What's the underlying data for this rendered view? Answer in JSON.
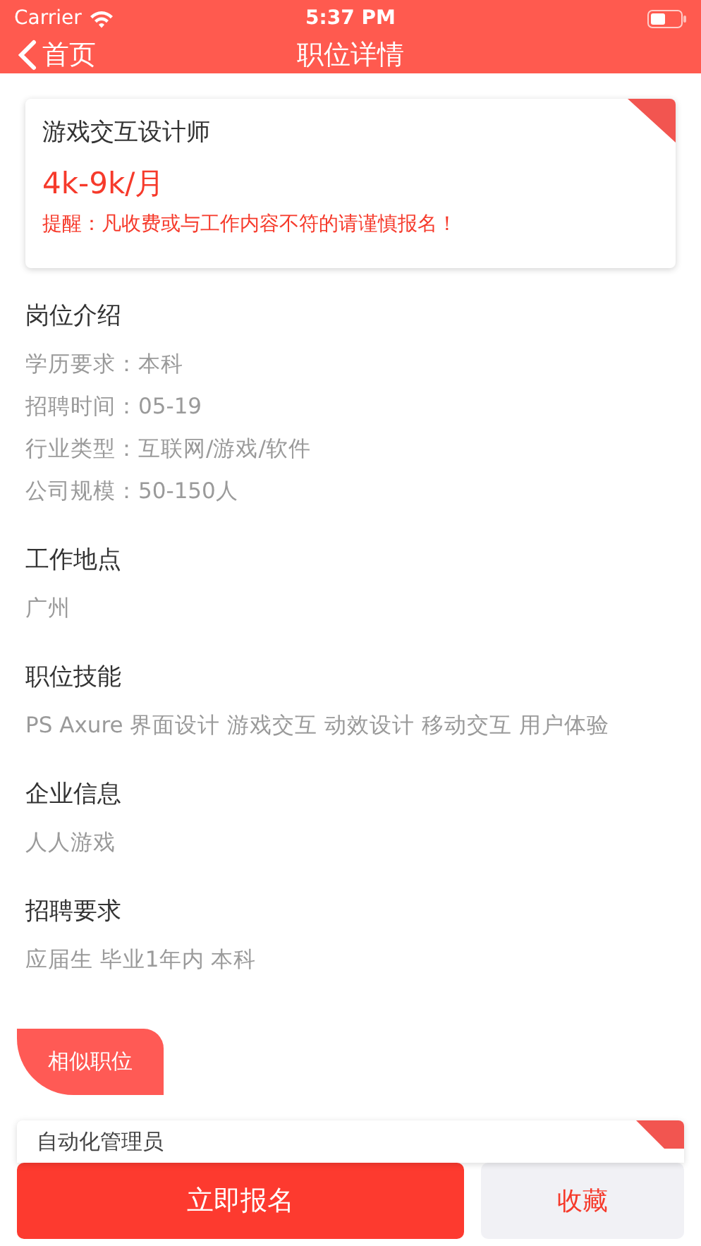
{
  "status_bar": {
    "carrier": "Carrier",
    "time": "5:37 PM"
  },
  "nav": {
    "back": "首页",
    "title": "职位详情"
  },
  "job": {
    "title": "游戏交互设计师",
    "salary": "4k-9k/月",
    "warning": "提醒：凡收费或与工作内容不符的请谨慎报名！"
  },
  "sections": [
    {
      "title": "岗位介绍",
      "lines": [
        "学历要求：本科",
        "招聘时间：05-19",
        "行业类型：互联网/游戏/软件",
        "公司规模：50-150人"
      ]
    },
    {
      "title": "工作地点",
      "lines": [
        "广州"
      ]
    },
    {
      "title": "职位技能",
      "lines": [
        "PS Axure 界面设计 游戏交互 动效设计 移动交互 用户体验"
      ]
    },
    {
      "title": "企业信息",
      "lines": [
        "人人游戏"
      ]
    },
    {
      "title": "招聘要求",
      "lines": [
        "应届生 毕业1年内 本科"
      ]
    }
  ],
  "similar": {
    "label": "相似职位",
    "items": [
      {
        "title": "自动化管理员"
      }
    ]
  },
  "actions": {
    "apply": "立即报名",
    "favorite": "收藏"
  }
}
